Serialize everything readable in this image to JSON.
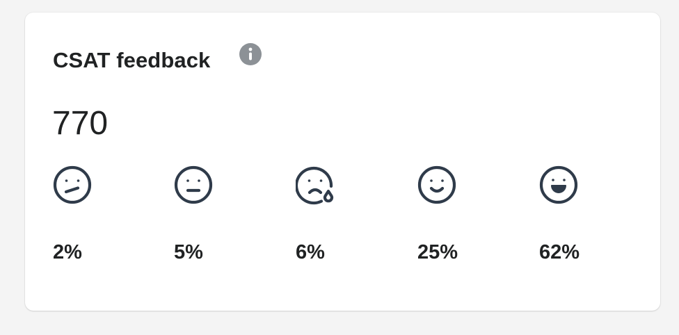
{
  "card": {
    "title": "CSAT feedback",
    "info_icon": "info-circle-icon",
    "total": "770"
  },
  "ratings": [
    {
      "icon": "confused-face-icon",
      "percent": "2%",
      "value": 0.02
    },
    {
      "icon": "neutral-face-icon",
      "percent": "5%",
      "value": 0.05
    },
    {
      "icon": "sad-tear-face-icon",
      "percent": "6%",
      "value": 0.06
    },
    {
      "icon": "smile-face-icon",
      "percent": "25%",
      "value": 0.25
    },
    {
      "icon": "grin-face-icon",
      "percent": "62%",
      "value": 0.62
    }
  ],
  "colors": {
    "background": "#f4f4f4",
    "card": "#ffffff",
    "text": "#202223",
    "icon_stroke": "#2f3b4a",
    "info_icon": "#8c9196"
  }
}
